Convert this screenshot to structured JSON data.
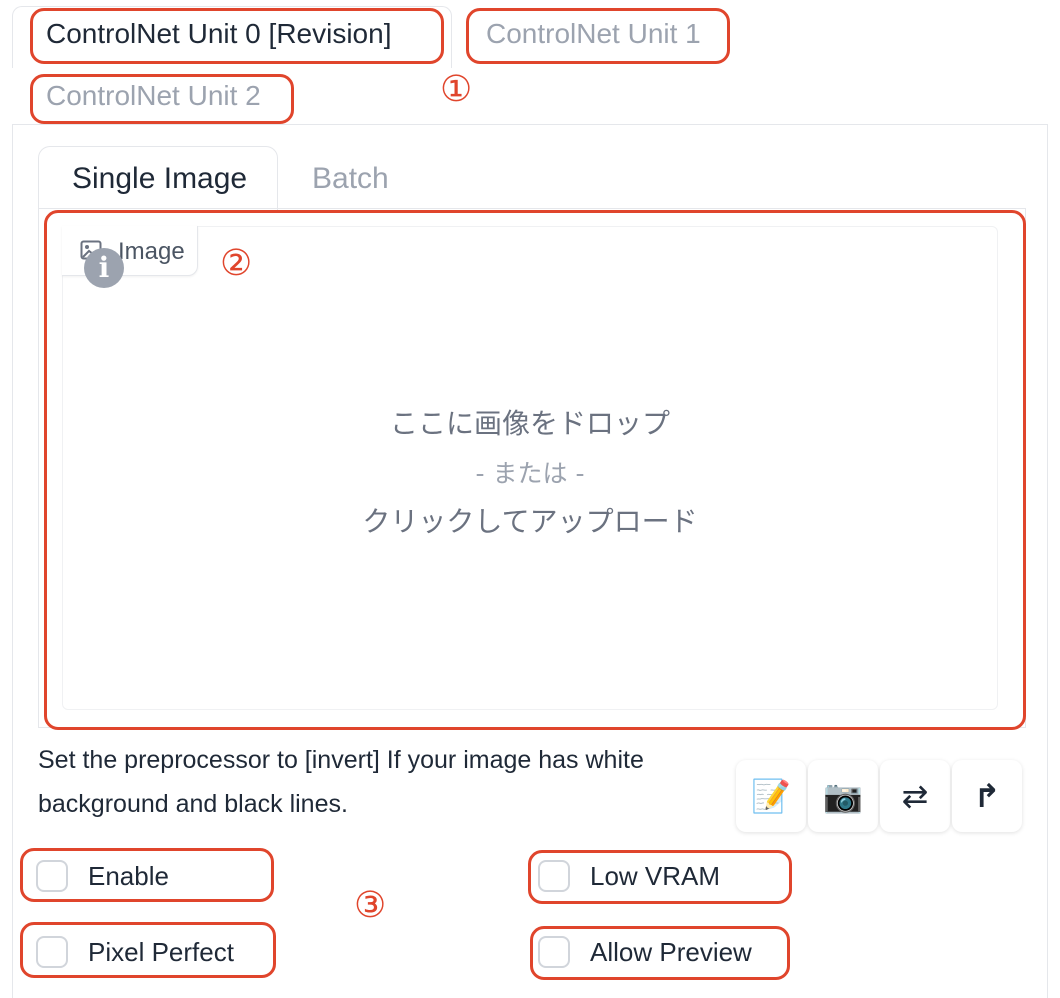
{
  "unit_tabs": [
    {
      "label": "ControlNet Unit 0 [Revision]",
      "active": true
    },
    {
      "label": "ControlNet Unit 1",
      "active": false
    },
    {
      "label": "ControlNet Unit 2",
      "active": false
    }
  ],
  "annotations": {
    "one": "①",
    "two": "②",
    "three": "③"
  },
  "image_tabs": [
    {
      "label": "Single Image",
      "active": true
    },
    {
      "label": "Batch",
      "active": false
    }
  ],
  "image_upload": {
    "label": "Image",
    "info_glyph": "i",
    "drop_text": "ここに画像をドロップ",
    "or_text": "- または -",
    "click_text": "クリックしてアップロード"
  },
  "hint_text": "Set the preprocessor to [invert] If your image has white background and black lines.",
  "tool_buttons": [
    {
      "icon": "memo-icon",
      "glyph": "📝"
    },
    {
      "icon": "camera-icon",
      "glyph": "📷"
    },
    {
      "icon": "swap-arrows-icon",
      "glyph": "⇄"
    },
    {
      "icon": "send-up-arrow-icon",
      "glyph": "↱"
    }
  ],
  "checkboxes": {
    "enable": {
      "label": "Enable",
      "checked": false
    },
    "low_vram": {
      "label": "Low VRAM",
      "checked": false
    },
    "pixel_perfect": {
      "label": "Pixel Perfect",
      "checked": false
    },
    "allow_preview": {
      "label": "Allow Preview",
      "checked": false
    }
  },
  "colors": {
    "annotation_red": "#e0452c",
    "muted_text": "#9ca3af",
    "border": "#e5e7eb"
  }
}
